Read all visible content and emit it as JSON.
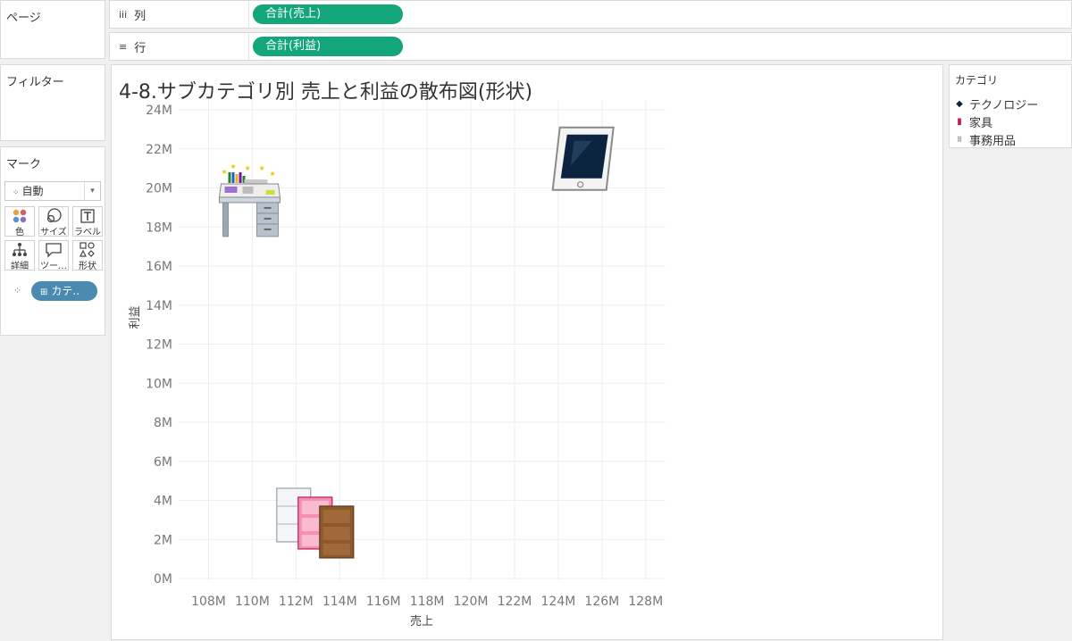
{
  "pages_card": {
    "title": "ページ"
  },
  "filters_card": {
    "title": "フィルター"
  },
  "marks_card": {
    "title": "マーク",
    "mark_type": "自動",
    "buttons": [
      {
        "label": "色",
        "icon": "color-icon"
      },
      {
        "label": "サイズ",
        "icon": "size-icon"
      },
      {
        "label": "ラベル",
        "icon": "label-icon"
      },
      {
        "label": "詳細",
        "icon": "detail-icon"
      },
      {
        "label": "ツー…",
        "icon": "tooltip-icon"
      },
      {
        "label": "形状",
        "icon": "shape-icon"
      }
    ],
    "shape_field": "カテ.."
  },
  "columns_shelf": {
    "label": "列",
    "field": "合計(売上)"
  },
  "rows_shelf": {
    "label": "行",
    "field": "合計(利益)"
  },
  "chart_title": "4-8.サブカテゴリ別 売上と利益の散布図(形状)",
  "legend": {
    "title": "カテゴリ",
    "items": [
      {
        "label": "テクノロジー",
        "icon": "tablet-icon"
      },
      {
        "label": "家具",
        "icon": "bookshelf-icon"
      },
      {
        "label": "事務用品",
        "icon": "desk-icon"
      }
    ]
  },
  "chart_data": {
    "type": "scatter",
    "xlabel": "売上",
    "ylabel": "利益",
    "x_ticks": [
      "108M",
      "110M",
      "112M",
      "114M",
      "116M",
      "118M",
      "120M",
      "122M",
      "124M",
      "126M",
      "128M"
    ],
    "y_ticks": [
      "0M",
      "2M",
      "4M",
      "6M",
      "8M",
      "10M",
      "12M",
      "14M",
      "16M",
      "18M",
      "20M",
      "22M",
      "24M"
    ],
    "xlim": [
      107,
      128.5
    ],
    "ylim": [
      0,
      24
    ],
    "grid": true,
    "points": [
      {
        "category": "テクノロジー",
        "x": 125.3,
        "y": 21.5,
        "shape": "tablet-icon"
      },
      {
        "category": "家具",
        "x": 113.0,
        "y": 2.7,
        "shape": "bookshelf-icon"
      },
      {
        "category": "事務用品",
        "x": 109.8,
        "y": 18.7,
        "shape": "desk-icon"
      }
    ]
  }
}
